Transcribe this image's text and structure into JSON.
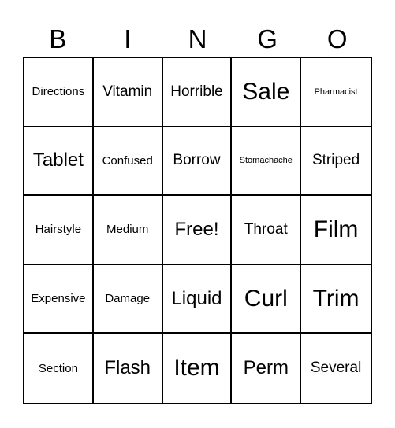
{
  "header": [
    "B",
    "I",
    "N",
    "G",
    "O"
  ],
  "rows": [
    [
      {
        "text": "Directions",
        "size": "s"
      },
      {
        "text": "Vitamin",
        "size": "m"
      },
      {
        "text": "Horrible",
        "size": "m"
      },
      {
        "text": "Sale",
        "size": "xl"
      },
      {
        "text": "Pharmacist",
        "size": "xs"
      }
    ],
    [
      {
        "text": "Tablet",
        "size": "l"
      },
      {
        "text": "Confused",
        "size": "s"
      },
      {
        "text": "Borrow",
        "size": "m"
      },
      {
        "text": "Stomachache",
        "size": "xs"
      },
      {
        "text": "Striped",
        "size": "m"
      }
    ],
    [
      {
        "text": "Hairstyle",
        "size": "s"
      },
      {
        "text": "Medium",
        "size": "s"
      },
      {
        "text": "Free!",
        "size": "l"
      },
      {
        "text": "Throat",
        "size": "m"
      },
      {
        "text": "Film",
        "size": "xl"
      }
    ],
    [
      {
        "text": "Expensive",
        "size": "s"
      },
      {
        "text": "Damage",
        "size": "s"
      },
      {
        "text": "Liquid",
        "size": "l"
      },
      {
        "text": "Curl",
        "size": "xl"
      },
      {
        "text": "Trim",
        "size": "xl"
      }
    ],
    [
      {
        "text": "Section",
        "size": "s"
      },
      {
        "text": "Flash",
        "size": "l"
      },
      {
        "text": "Item",
        "size": "xl"
      },
      {
        "text": "Perm",
        "size": "l"
      },
      {
        "text": "Several",
        "size": "m"
      }
    ]
  ]
}
